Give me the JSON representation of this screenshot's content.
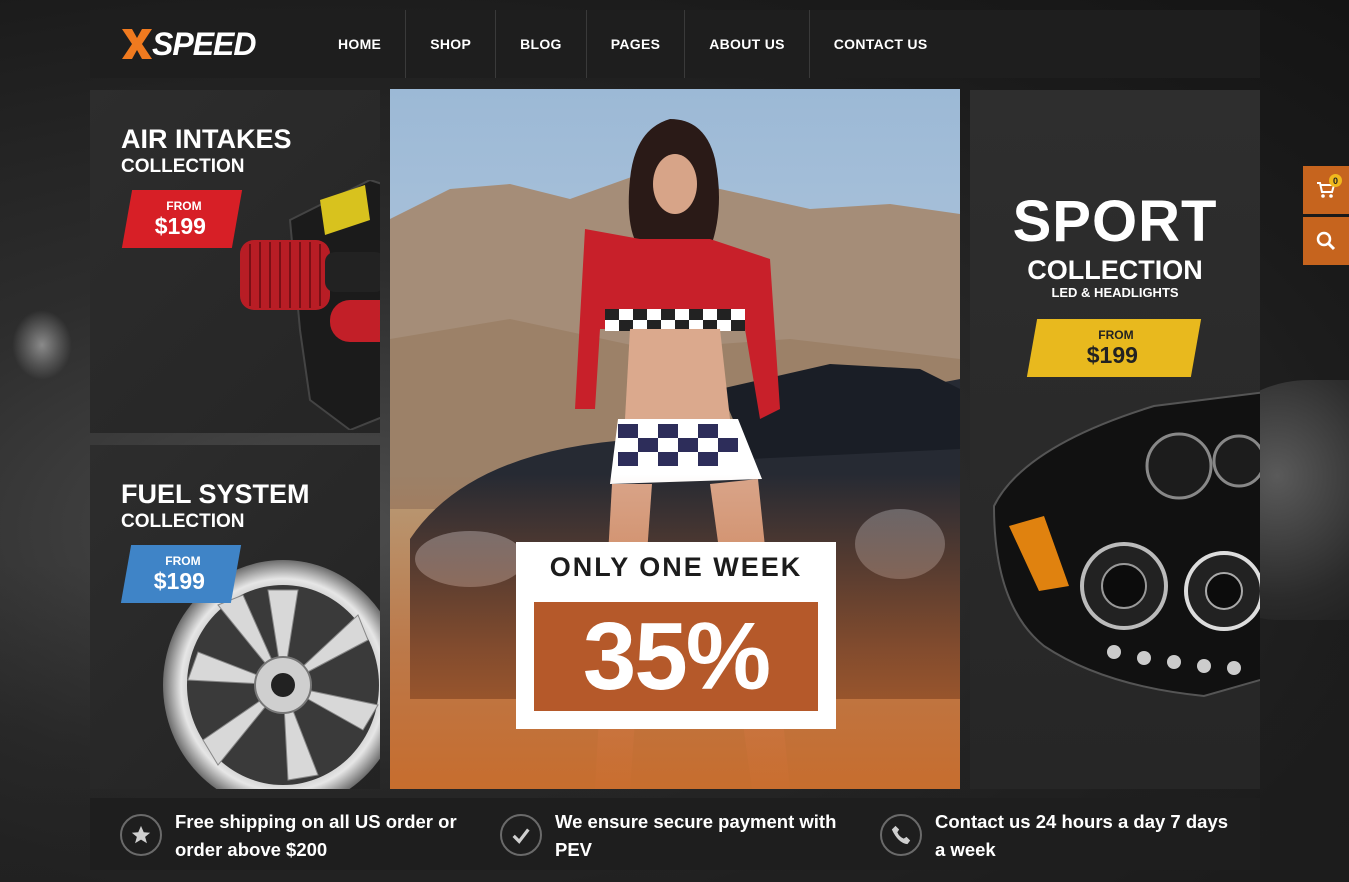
{
  "brand": {
    "logo_text": "SPEED",
    "logo_letter": "X",
    "accent": "#f07a1f"
  },
  "nav": {
    "items": [
      "HOME",
      "SHOP",
      "BLOG",
      "PAGES",
      "ABOUT US",
      "CONTACT US"
    ]
  },
  "air_intakes": {
    "title": "AIR INTAKES",
    "subtitle": "COLLECTION",
    "price_from": "FROM",
    "price": "$199",
    "tag_color": "#d71f26"
  },
  "fuel_system": {
    "title": "FUEL SYSTEM",
    "subtitle": "COLLECTION",
    "price_from": "FROM",
    "price": "$199",
    "tag_color": "#3f84c7"
  },
  "hero": {
    "promo_top": "ONLY ONE WEEK",
    "promo_value": "35%",
    "overlay_color": "#c0622a"
  },
  "sport": {
    "title": "SPORT",
    "subtitle": "COLLECTION",
    "detail": "LED & HEADLIGHTS",
    "price_from": "FROM",
    "price": "$199",
    "tag_color": "#e8b91e"
  },
  "side": {
    "cart_count": "0",
    "cart_icon": "cart-icon",
    "search_icon": "search-icon"
  },
  "features": [
    {
      "icon": "star-icon",
      "text": "Free shipping on all US order or order above $200"
    },
    {
      "icon": "checkmark-icon",
      "text": "We ensure secure payment with PEV"
    },
    {
      "icon": "phone-icon",
      "text": "Contact us 24 hours a day 7 days a week"
    }
  ]
}
